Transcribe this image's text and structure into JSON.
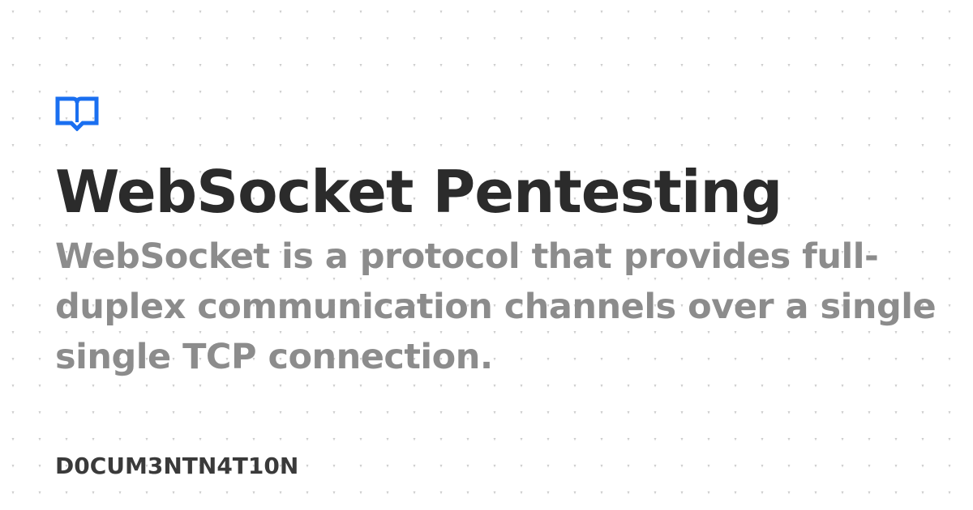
{
  "card": {
    "logo_icon": "book-open-icon",
    "title": "WebSocket Pentesting",
    "description": "WebSocket is a protocol that provides full-duplex communication channels over a single single TCP connection.",
    "brand": "D0CUM3NTN4T10N"
  },
  "colors": {
    "background": "#ffffff",
    "dots": "#c9c9c9",
    "logo": "#1a6ff0",
    "title": "#2b2b2b",
    "description": "#8c8c8c",
    "brand": "#3a3a3a"
  }
}
